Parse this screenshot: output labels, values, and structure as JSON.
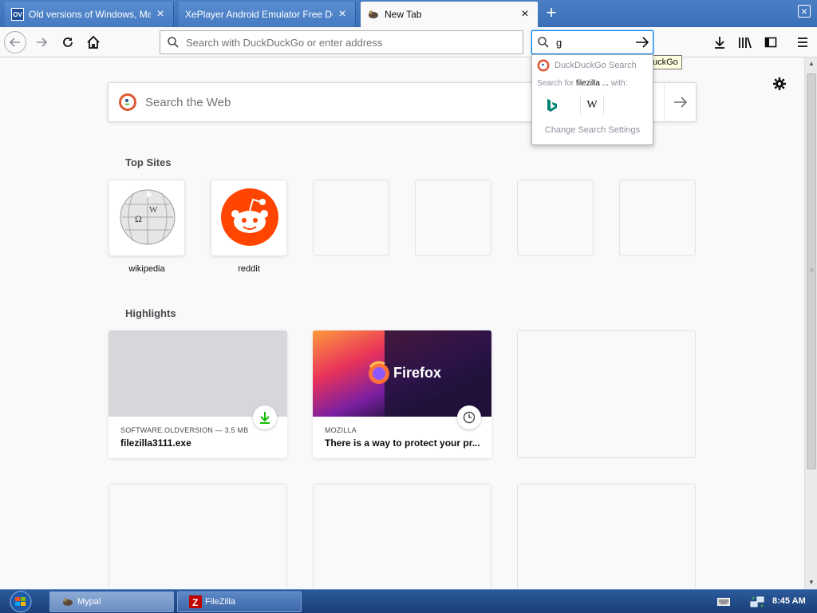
{
  "tabs": [
    {
      "title": "Old versions of Windows, Mac a",
      "favicon": "OV"
    },
    {
      "title": "XePlayer Android Emulator Free Dow",
      "favicon": ""
    },
    {
      "title": "New Tab",
      "favicon": "mypal-icon"
    }
  ],
  "navbar": {
    "url_placeholder": "Search with DuckDuckGo or enter address",
    "search_value": "g"
  },
  "search_popup": {
    "engine_name": "DuckDuckGo Search",
    "search_for_prefix": "Search for ",
    "search_for_query": "filezilla ...",
    "search_for_suffix": " with:",
    "engines": [
      "Bing",
      "Wikipedia"
    ],
    "change_settings": "Change Search Settings",
    "tooltip": "uckGo"
  },
  "content": {
    "web_search_placeholder": "Search the Web",
    "top_sites_title": "Top Sites",
    "top_sites": [
      {
        "label": "wikipedia"
      },
      {
        "label": "reddit"
      },
      {
        "label": ""
      },
      {
        "label": ""
      },
      {
        "label": ""
      },
      {
        "label": ""
      }
    ],
    "highlights_title": "Highlights",
    "highlights": [
      {
        "source": "SOFTWARE.OLDVERSION — 3.5 MB",
        "title": "filezilla3111.exe",
        "badge": "download-icon"
      },
      {
        "source": "MOZILLA",
        "title": "There is a way to protect your pr...",
        "badge": "clock-icon",
        "thumb_text": "Firefox"
      }
    ]
  },
  "taskbar": {
    "items": [
      {
        "label": "Mypal"
      },
      {
        "label": "FileZilla"
      }
    ],
    "clock": "8:45 AM"
  },
  "colors": {
    "accent": "#0a84ff",
    "reddit": "#ff4500",
    "download_green": "#12bc00"
  }
}
